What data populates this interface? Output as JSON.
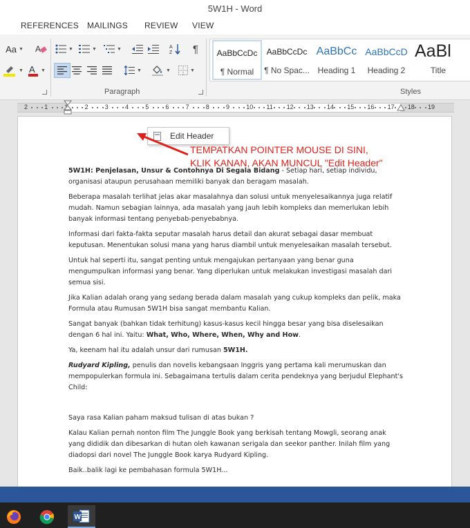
{
  "window": {
    "title": "5W1H - Word"
  },
  "tabs": [
    "REFERENCES",
    "MAILINGS",
    "REVIEW",
    "VIEW"
  ],
  "ribbon": {
    "font_size_label": "Aa",
    "paragraph_group_label": "Paragraph",
    "styles_group_label": "Styles",
    "styles": [
      {
        "sample": "AaBbCcDc",
        "name": "¶ Normal",
        "selected": true,
        "color": "#222222"
      },
      {
        "sample": "AaBbCcDc",
        "name": "¶ No Spac...",
        "selected": false,
        "color": "#222222"
      },
      {
        "sample": "AaBbCc",
        "name": "Heading 1",
        "selected": false,
        "color": "#2e74b5"
      },
      {
        "sample": "AaBbCcD",
        "name": "Heading 2",
        "selected": false,
        "color": "#2e74b5"
      },
      {
        "sample": "AaBl",
        "name": "Title",
        "selected": false,
        "color": "#111111"
      }
    ]
  },
  "ruler": {
    "numbers": [
      "2",
      "1",
      "1",
      "2",
      "3",
      "4",
      "5",
      "6",
      "7",
      "8",
      "9",
      "10",
      "11",
      "12",
      "13",
      "14",
      "15",
      "16",
      "17",
      "18",
      "19"
    ]
  },
  "context_menu": {
    "label": "Edit Header"
  },
  "annotation": {
    "line1": "TEMPATKAN POINTER MOUSE DI SINI,",
    "line2": "KLIK KANAN, AKAN MUNCUL \"Edit Header\"",
    "color": "#e0201a"
  },
  "document": {
    "p1_bold": "5W1H: Penjelasan, Unsur & Contohnya Di Segala Bidang",
    "p1_rest": " - Setiap hari, setiap individu, organisasi ataupun perusahaan memiliki banyak dan beragam masalah.",
    "p2": "Beberapa masalah terlihat jelas akar masalahnya dan solusi untuk menyelesaikannya juga relatif mudah. Namun sebagian lainnya, ada masalah yang jauh lebih kompleks dan memerlukan lebih banyak informasi tentang penyebab-penyebabnya.",
    "p3": "Informasi dari fakta-fakta seputar masalah harus detail dan akurat sebagai dasar membuat keputusan. Menentukan solusi mana yang harus diambil untuk menyelesaikan masalah tersebut.",
    "p4": "Untuk hal seperti itu, sangat penting untuk mengajukan pertanyaan yang benar guna mengumpulkan informasi yang benar. Yang diperlukan untuk melakukan investigasi masalah dari semua sisi.",
    "p5": "Jika Kalian adalah orang yang sedang berada dalam masalah yang cukup kompleks dan pelik, maka Formula atau Rumusan 5W1H bisa sangat membantu Kalian.",
    "p6_start": "Sangat banyak (bahkan tidak terhitung) kasus-kasus kecil hingga besar yang bisa diselesaikan dengan 6 hal ini. Yaitu: ",
    "p6_bold": "What, Who, Where, When, Why and How",
    "p6_end": ".",
    "p7_start": "Ya, keenam hal itu adalah unsur dari rumusan ",
    "p7_bold": "5W1H.",
    "p8_bolditalic": "Rudyard Kipling,",
    "p8_rest": " penulis dan novelis kebangsaan Inggris yang pertama kali merumuskan dan mempopulerkan formula ini. Sebagaimana tertulis dalam cerita pendeknya yang berjudul Elephant's Child:",
    "p9": "Saya rasa Kalian paham maksud tulisan di atas bukan ?",
    "p10": "Kalau Kalian pernah nonton film The Junggle Book yang berkisah tentang Mowgli, seorang anak yang dididik dan dibesarkan di hutan oleh kawanan serigala dan seekor panther. Inilah film yang diadopsi dari novel The Junggle Book karya Rudyard Kipling.",
    "p11": "Baik..balik lagi ke pembahasan formula 5W1H..."
  },
  "colors": {
    "statusbar": "#2b579a",
    "taskbar": "#202020",
    "accent": "#2b579a"
  },
  "taskbar": {
    "apps": [
      "firefox-icon",
      "chrome-icon",
      "word-icon"
    ]
  }
}
